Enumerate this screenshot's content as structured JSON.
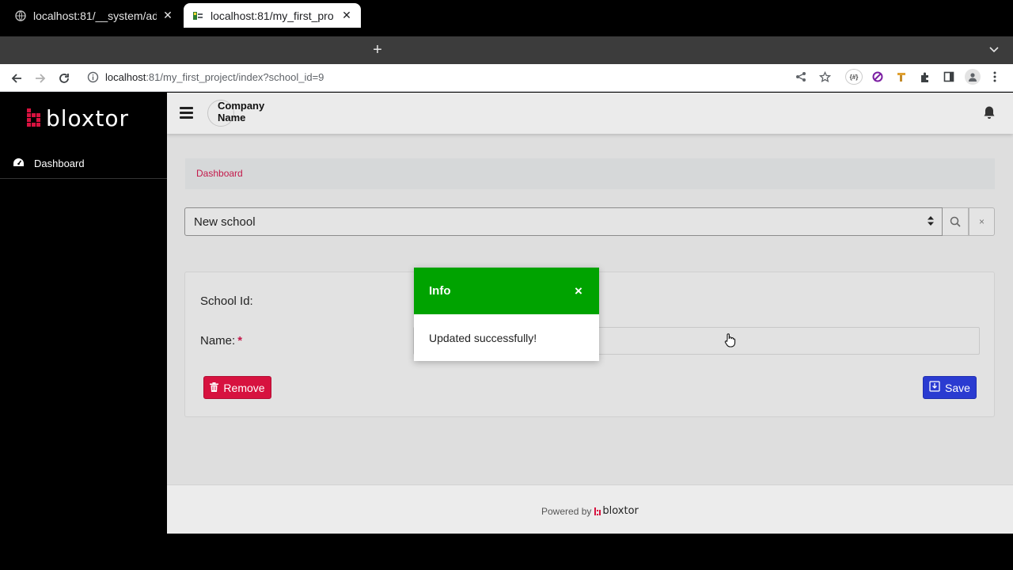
{
  "browser": {
    "tabs": [
      {
        "title": "localhost:81/__system/ad",
        "close": "✕",
        "active": false
      },
      {
        "title": "localhost:81/my_first_pro",
        "close": "✕",
        "active": true
      }
    ],
    "new_tab": "+",
    "tab_menu": "⌄",
    "url_host": "localhost",
    "url_rest": ":81/my_first_project/index?school_id=9"
  },
  "app": {
    "brand": "bloxtor",
    "company_line1": "Company",
    "company_line2": "Name",
    "nav": [
      {
        "label": "Dashboard"
      }
    ],
    "breadcrumb": "Dashboard",
    "select": {
      "value": "New school"
    },
    "clear_label": "×",
    "form": {
      "id_label": "School Id:",
      "name_label": "Name:",
      "required_mark": "*",
      "name_value": ""
    },
    "remove_label": "Remove",
    "save_label": "Save",
    "footer_prefix": "Powered by",
    "footer_brand": "bloxtor"
  },
  "toast": {
    "title": "Info",
    "close": "×",
    "message": "Updated successfully!",
    "color": "#00a300"
  },
  "colors": {
    "accent_red": "#d7123f",
    "save_blue": "#2a3bd1",
    "breadcrumb_link": "#c3194a"
  }
}
